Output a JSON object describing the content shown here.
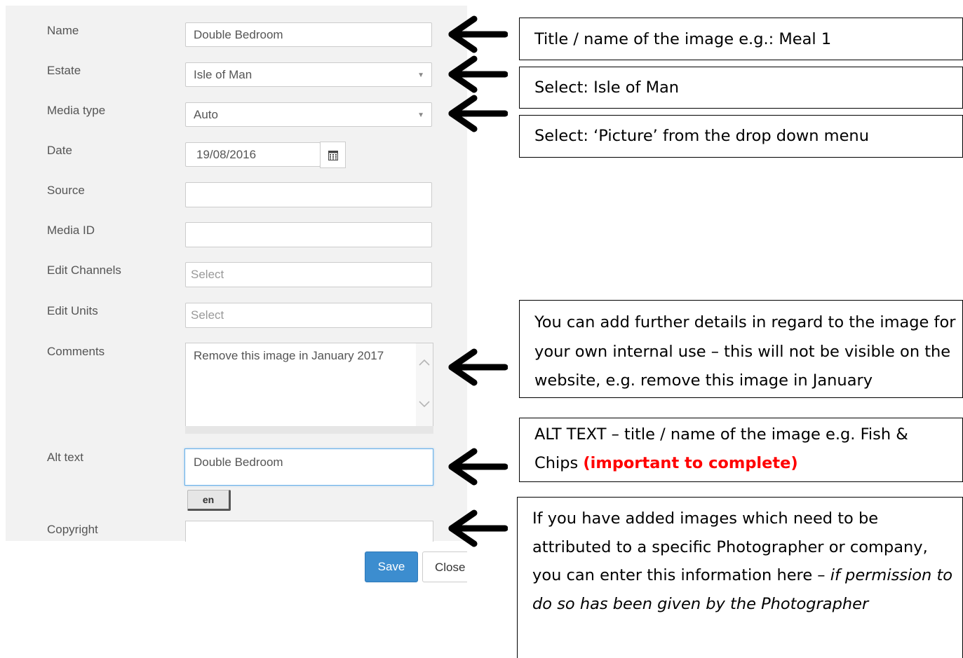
{
  "form": {
    "fields": {
      "name": {
        "label": "Name",
        "value": "Double Bedroom"
      },
      "estate": {
        "label": "Estate",
        "value": "Isle of Man"
      },
      "media_type": {
        "label": "Media type",
        "value": "Auto"
      },
      "date": {
        "label": "Date",
        "value": "19/08/2016"
      },
      "source": {
        "label": "Source",
        "value": ""
      },
      "media_id": {
        "label": "Media ID",
        "value": ""
      },
      "edit_channels": {
        "label": "Edit Channels",
        "placeholder": "Select"
      },
      "edit_units": {
        "label": "Edit Units",
        "placeholder": "Select"
      },
      "comments": {
        "label": "Comments",
        "value": "Remove this image in January 2017"
      },
      "alt_text": {
        "label": "Alt text",
        "value": "Double Bedroom",
        "language": "en"
      },
      "copyright": {
        "label": "Copyright",
        "value": ""
      }
    },
    "buttons": {
      "save": "Save",
      "close": "Close"
    },
    "colors": {
      "save_button": "#3c8dcf",
      "focus_border": "#66afe9"
    },
    "icons": {
      "date_picker": "calendar-icon",
      "dropdown": "caret-down-icon",
      "scroll": "chevron-icon"
    }
  },
  "notes": {
    "name": "Title / name of the image e.g.: Meal 1",
    "estate": "Select: Isle of Man",
    "media_type": "Select: ‘Picture’ from the drop down menu",
    "comments": "You can add further details in regard to the image for your own internal use – this will not be visible on the website, e.g. remove this image in January",
    "alt_text_main": "ALT TEXT – title / name of the image e.g. Fish & Chips",
    "alt_text_emphasis": "(important to complete)",
    "copyright_main": "If you have added images which need to be attributed to a specific Photographer or company, you can enter this information here –",
    "copyright_italic": "if permission to do so has been given by the Photographer",
    "colors": {
      "emphasis": "#ff0000"
    }
  }
}
